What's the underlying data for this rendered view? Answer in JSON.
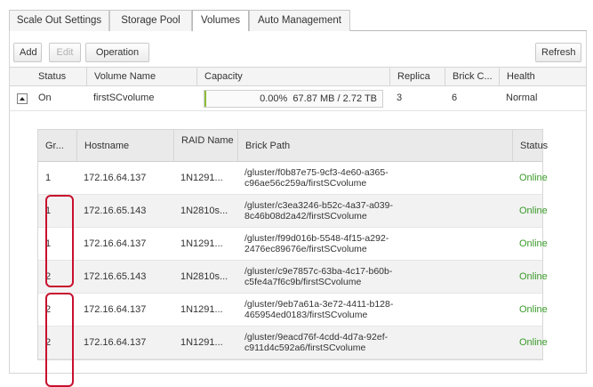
{
  "tabs": [
    {
      "label": "Scale Out Settings",
      "active": false
    },
    {
      "label": "Storage Pool",
      "active": false
    },
    {
      "label": "Volumes",
      "active": true
    },
    {
      "label": "Auto Management",
      "active": false
    }
  ],
  "toolbar": {
    "add_label": "Add",
    "edit_label": "Edit",
    "operation_label": "Operation",
    "refresh_label": "Refresh"
  },
  "volumes": {
    "columns": [
      "Status",
      "Volume Name",
      "Capacity",
      "Replica",
      "Brick C...",
      "Health"
    ],
    "rows": [
      {
        "status": "On",
        "name": "firstSCvolume",
        "capacity_percent_text": "0.00%",
        "capacity_text": "67.87 MB / 2.72 TB",
        "capacity_fraction": 0.0,
        "replica": "3",
        "brick_count": "6",
        "health": "Normal"
      }
    ]
  },
  "bricks": {
    "columns": [
      "Gr...",
      "Hostname",
      "RAID Name",
      "Brick Path",
      "Status"
    ],
    "rows": [
      {
        "group": "1",
        "hostname": "172.16.64.137",
        "raid": "1N1291...",
        "path_line1": "/gluster/f0b87e75-9cf3-4e60-a365-",
        "path_line2": "c96ae56c259a/firstSCvolume",
        "status": "Online"
      },
      {
        "group": "1",
        "hostname": "172.16.65.143",
        "raid": "1N2810s...",
        "path_line1": "/gluster/c3ea3246-b52c-4a37-a039-",
        "path_line2": "8c46b08d2a42/firstSCvolume",
        "status": "Online"
      },
      {
        "group": "1",
        "hostname": "172.16.64.137",
        "raid": "1N1291...",
        "path_line1": "/gluster/f99d016b-5548-4f15-a292-",
        "path_line2": "2476ec89676e/firstSCvolume",
        "status": "Online"
      },
      {
        "group": "2",
        "hostname": "172.16.65.143",
        "raid": "1N2810s...",
        "path_line1": "/gluster/c9e7857c-63ba-4c17-b60b-",
        "path_line2": "c5fe4a7f6c9b/firstSCvolume",
        "status": "Online"
      },
      {
        "group": "2",
        "hostname": "172.16.64.137",
        "raid": "1N1291...",
        "path_line1": "/gluster/9eb7a61a-3e72-4411-b128-",
        "path_line2": "465954ed0183/firstSCvolume",
        "status": "Online"
      },
      {
        "group": "2",
        "hostname": "172.16.64.137",
        "raid": "1N1291...",
        "path_line1": "/gluster/9eacd76f-4cdd-4d7a-92ef-",
        "path_line2": "c911d4c592a6/firstSCvolume",
        "status": "Online"
      }
    ]
  },
  "colors": {
    "online": "#3a9a2a",
    "capacity_bar": "#8fbc3f",
    "highlight": "#c8102e"
  }
}
